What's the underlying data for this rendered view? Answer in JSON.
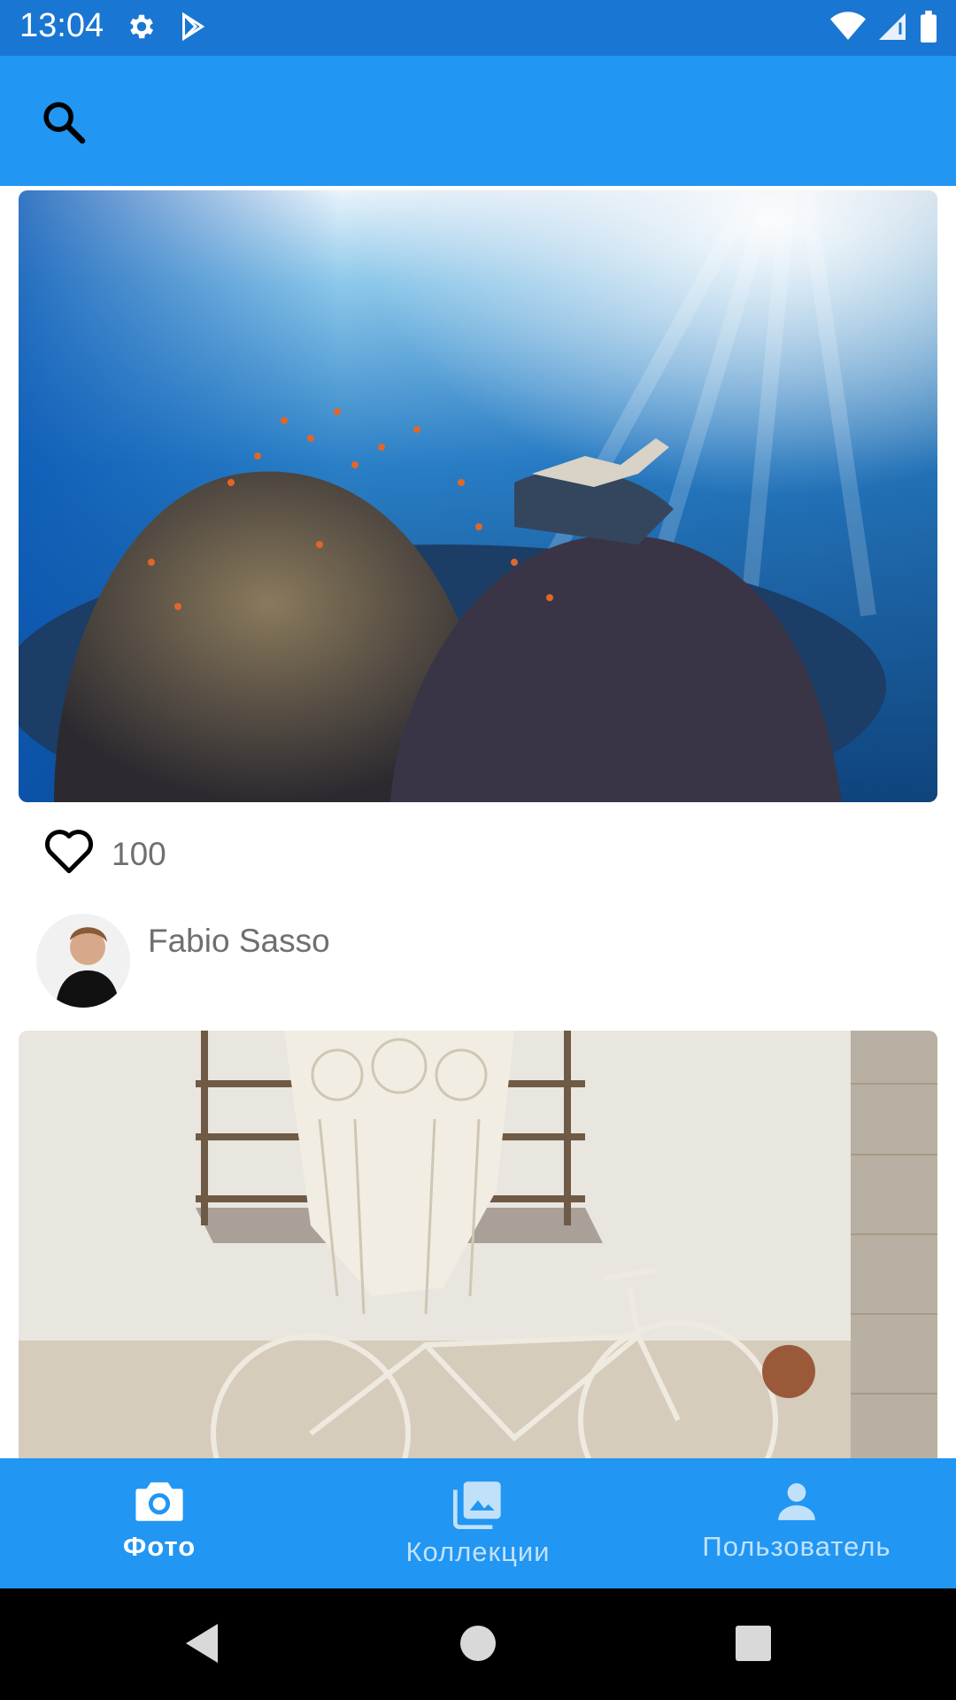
{
  "status_bar": {
    "time": "13:04",
    "icons_left": [
      "gear-icon",
      "play-store-icon"
    ],
    "icons_right": [
      "wifi-icon",
      "signal-icon",
      "battery-icon"
    ]
  },
  "app_bar": {
    "icon": "search-icon",
    "color": "#2196f3"
  },
  "feed": [
    {
      "image": "underwater coral reef with diver",
      "likes": "100",
      "author": "Fabio Sasso"
    },
    {
      "image": "bicycle against white wall with macrame"
    }
  ],
  "bottom_nav": {
    "items": [
      {
        "label": "Фото",
        "icon": "camera-icon",
        "active": true
      },
      {
        "label": "Коллекции",
        "icon": "collections-icon",
        "active": false
      },
      {
        "label": "Пользователь",
        "icon": "person-icon",
        "active": false
      }
    ]
  },
  "colors": {
    "status_bar": "#1976d2",
    "primary": "#2196f3"
  }
}
